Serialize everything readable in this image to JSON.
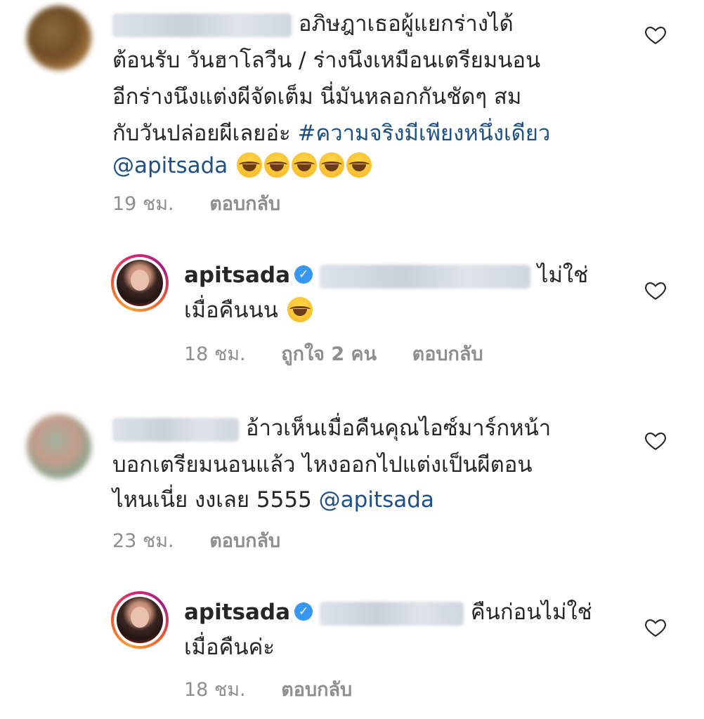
{
  "comments": [
    {
      "text_segments": {
        "l1": "อภิษฎาเธอผู้แยกร่างได้",
        "l2": "ต้อนรับ วันฮาโลวีน / ร่างนึงเหมือนเตรียมนอน",
        "l3": "อีกร่างนึงแต่งผีจัดเต็ม  นี่มันหลอกกันชัดๆ สม",
        "l4a": "กับวันปล่อยผีเลยอ่ะ ",
        "hashtag": "#ความจริงมีเพียงหนึ่งเดียว",
        "mention": "@apitsada"
      },
      "time": "19 ชม.",
      "reply": "ตอบกลับ"
    },
    {
      "username": "apitsada",
      "text_a": "ไม่ใช่",
      "text_b": "เมื่อคืนนน",
      "time": "18 ชม.",
      "likes": "ถูกใจ 2 คน",
      "reply": "ตอบกลับ"
    },
    {
      "text_segments": {
        "l1": "อ้าวเห็นเมื่อคืนคุณไอซ์มาร์กหน้า",
        "l2": "บอกเตรียมนอนแล้ว ไหงออกไปแต่งเป็นผีตอน",
        "l3a": "ไหนเนี่ย งงเลย 5555 ",
        "mention": "@apitsada"
      },
      "time": "23 ชม.",
      "reply": "ตอบกลับ"
    },
    {
      "username": "apitsada",
      "text_a": "คืนก่อนไม่ใช่",
      "text_b": "เมื่อคืนค่ะ",
      "time": "18 ชม.",
      "reply": "ตอบกลับ"
    }
  ],
  "icons": {
    "heart": "heart-outline-icon",
    "verified": "verified-badge-icon",
    "emoji": "face-with-tears-of-joy-emoji"
  },
  "colors": {
    "link": "#1e4f85",
    "meta": "#8e8e8e",
    "verified": "#3897f0"
  }
}
